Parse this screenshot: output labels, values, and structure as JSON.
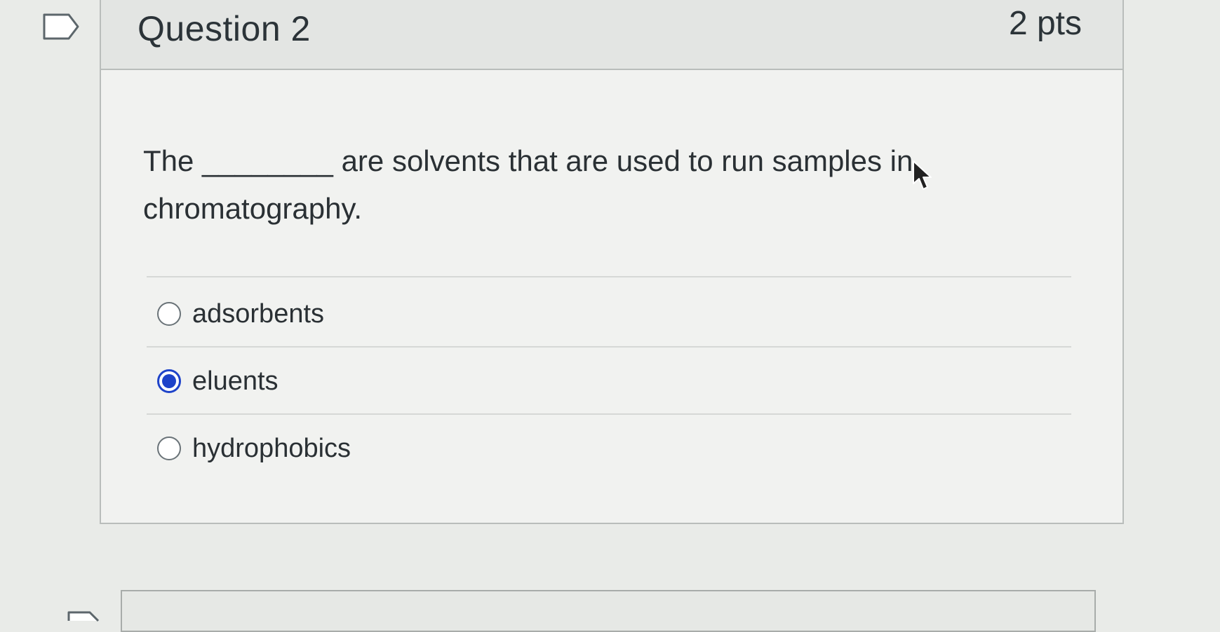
{
  "question": {
    "title": "Question 2",
    "points": "2 pts",
    "text": "The ________ are solvents that are used to run samples in chromatography.",
    "answers": [
      {
        "label": "adsorbents",
        "selected": false
      },
      {
        "label": "eluents",
        "selected": true
      },
      {
        "label": "hydrophobics",
        "selected": false
      }
    ]
  },
  "icons": {
    "flag": "flag-question-icon",
    "cursor": "mouse-pointer-icon"
  },
  "colors": {
    "selected_radio": "#1e43c9",
    "header_bg": "#e3e5e3",
    "card_bg": "#f1f2f0"
  }
}
